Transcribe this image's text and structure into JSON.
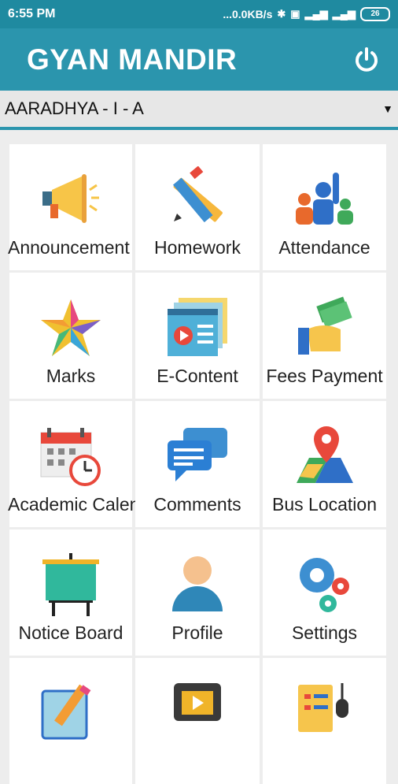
{
  "status": {
    "time": "6:55 PM",
    "speed": "...0.0KB/s",
    "battery": "26"
  },
  "app": {
    "title": "GYAN MANDIR"
  },
  "student_selector": {
    "value": "AARADHYA - I - A"
  },
  "tiles": [
    {
      "label": "Announcement",
      "icon": "megaphone-icon"
    },
    {
      "label": "Homework",
      "icon": "pencil-ruler-icon"
    },
    {
      "label": "Attendance",
      "icon": "people-hand-raised-icon"
    },
    {
      "label": "Marks",
      "icon": "star-icon"
    },
    {
      "label": "E-Content",
      "icon": "video-document-icon"
    },
    {
      "label": "Fees Payment",
      "icon": "cash-hand-icon"
    },
    {
      "label": "Academic Calendar",
      "icon": "calendar-clock-icon"
    },
    {
      "label": "Comments",
      "icon": "chat-bubbles-icon"
    },
    {
      "label": "Bus Location",
      "icon": "map-pin-icon"
    },
    {
      "label": "Notice Board",
      "icon": "board-icon"
    },
    {
      "label": "Profile",
      "icon": "user-icon"
    },
    {
      "label": "Settings",
      "icon": "gears-icon"
    },
    {
      "label": "",
      "icon": "edit-note-icon"
    },
    {
      "label": "",
      "icon": "video-player-icon"
    },
    {
      "label": "",
      "icon": "checklist-mouse-icon"
    }
  ],
  "colors": {
    "primary": "#2b95ad",
    "statusbar": "#1f8aa0",
    "background": "#ededed"
  }
}
